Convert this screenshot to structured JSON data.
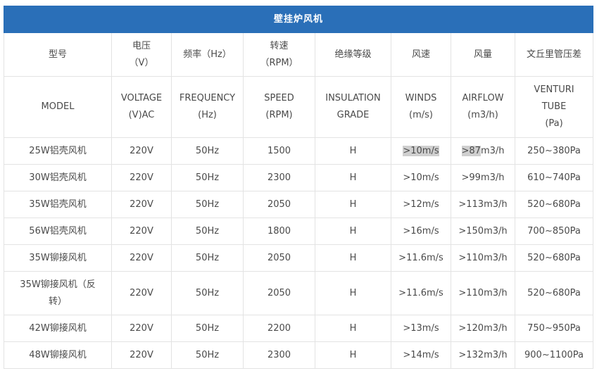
{
  "table": {
    "title": "壁挂炉风机",
    "header_cn": [
      {
        "line1": "型号",
        "line2": ""
      },
      {
        "line1": "电压",
        "line2": "（V）"
      },
      {
        "line1": "频率（Hz）",
        "line2": ""
      },
      {
        "line1": "转速",
        "line2": "（RPM）"
      },
      {
        "line1": "绝缘等级",
        "line2": ""
      },
      {
        "line1": "风速",
        "line2": ""
      },
      {
        "line1": "风量",
        "line2": ""
      },
      {
        "line1": "文丘里管压差",
        "line2": ""
      }
    ],
    "header_en": [
      {
        "line1": "MODEL",
        "line2": "",
        "line3": ""
      },
      {
        "line1": "VOLTAGE",
        "line2": "(V)AC",
        "line3": ""
      },
      {
        "line1": "FREQUENCY",
        "line2": "(Hz)",
        "line3": ""
      },
      {
        "line1": "SPEED",
        "line2": "(RPM)",
        "line3": ""
      },
      {
        "line1": "INSULATION",
        "line2": "GRADE",
        "line3": ""
      },
      {
        "line1": "WINDS",
        "line2": "(m/s)",
        "line3": ""
      },
      {
        "line1": "AIRFLOW",
        "line2": "(m3/h)",
        "line3": ""
      },
      {
        "line1": "VENTURI",
        "line2": "TUBE",
        "line3": "(Pa)"
      }
    ],
    "rows": [
      {
        "model": "25W铝壳风机",
        "model2": "",
        "voltage": "220V",
        "frequency": "50Hz",
        "speed": "1500",
        "grade": "H",
        "winds": ">10m/s",
        "airflow_a": ">87",
        "airflow_b": "m3/h",
        "venturi": "250~380Pa"
      },
      {
        "model": "30W铝壳风机",
        "model2": "",
        "voltage": "220V",
        "frequency": "50Hz",
        "speed": "2300",
        "grade": "H",
        "winds": ">10m/s",
        "airflow_a": ">99m3/h",
        "airflow_b": "",
        "venturi": "610~740Pa"
      },
      {
        "model": "35W铝壳风机",
        "model2": "",
        "voltage": "220V",
        "frequency": "50Hz",
        "speed": "2050",
        "grade": "H",
        "winds": ">12m/s",
        "airflow_a": ">113m3/h",
        "airflow_b": "",
        "venturi": "520~680Pa"
      },
      {
        "model": "56W铝壳风机",
        "model2": "",
        "voltage": "220V",
        "frequency": "50Hz",
        "speed": "1800",
        "grade": "H",
        "winds": ">16m/s",
        "airflow_a": ">150m3/h",
        "airflow_b": "",
        "venturi": "700~850Pa"
      },
      {
        "model": "35W铆接风机",
        "model2": "",
        "voltage": "220V",
        "frequency": "50Hz",
        "speed": "2050",
        "grade": "H",
        "winds": ">11.6m/s",
        "airflow_a": ">110m3/h",
        "airflow_b": "",
        "venturi": "520~680Pa"
      },
      {
        "model": "35W铆接风机（反",
        "model2": "转）",
        "voltage": "220V",
        "frequency": "50Hz",
        "speed": "2050",
        "grade": "H",
        "winds": ">11.6m/s",
        "airflow_a": ">110m3/h",
        "airflow_b": "",
        "venturi": "520~680Pa"
      },
      {
        "model": "42W铆接风机",
        "model2": "",
        "voltage": "220V",
        "frequency": "50Hz",
        "speed": "2200",
        "grade": "H",
        "winds": ">13m/s",
        "airflow_a": ">120m3/h",
        "airflow_b": "",
        "venturi": "750~950Pa"
      },
      {
        "model": "48W铆接风机",
        "model2": "",
        "voltage": "220V",
        "frequency": "50Hz",
        "speed": "2300",
        "grade": "H",
        "winds": ">14m/s",
        "airflow_a": ">132m3/h",
        "airflow_b": "",
        "venturi": "900~1100Pa"
      }
    ]
  }
}
